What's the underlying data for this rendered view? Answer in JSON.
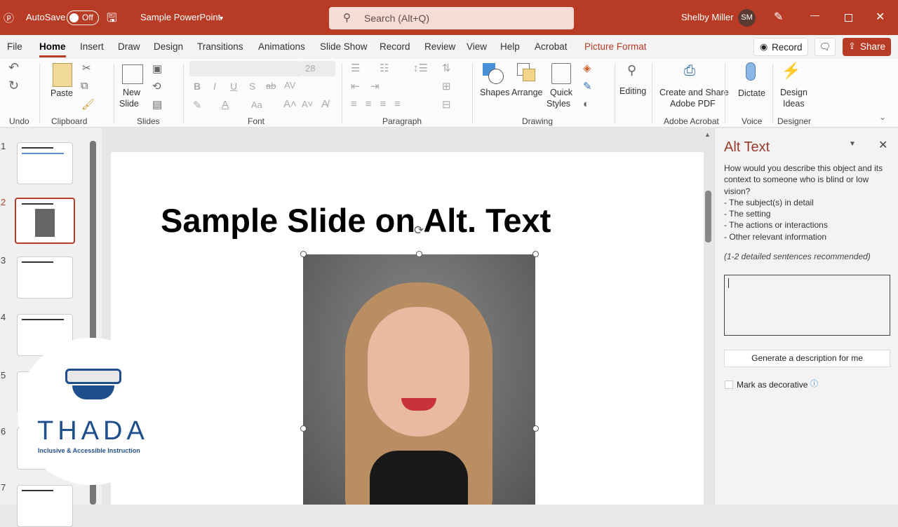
{
  "titlebar": {
    "autosave_label": "AutoSave",
    "autosave_state": "Off",
    "doc_title": "Sample PowerPoint",
    "search_placeholder": "Search (Alt+Q)",
    "user_name": "Shelby Miller",
    "user_initials": "SM"
  },
  "tabs": [
    "File",
    "Home",
    "Insert",
    "Draw",
    "Design",
    "Transitions",
    "Animations",
    "Slide Show",
    "Record",
    "Review",
    "View",
    "Help",
    "Acrobat",
    "Picture Format"
  ],
  "tab_actions": {
    "record": "Record",
    "share": "Share"
  },
  "ribbon": {
    "undo_group": "Undo",
    "clipboard_group": "Clipboard",
    "paste": "Paste",
    "slides_group": "Slides",
    "new_slide_1": "New",
    "new_slide_2": "Slide",
    "font_group": "Font",
    "font_size": "28",
    "paragraph_group": "Paragraph",
    "shapes": "Shapes",
    "arrange": "Arrange",
    "quick_styles_1": "Quick",
    "quick_styles_2": "Styles",
    "drawing_group": "Drawing",
    "editing": "Editing",
    "acrobat_1": "Create and Share",
    "acrobat_2": "Adobe PDF",
    "acrobat_group": "Adobe Acrobat",
    "dictate": "Dictate",
    "voice_group": "Voice",
    "design_ideas_1": "Design",
    "design_ideas_2": "Ideas",
    "designer_group": "Designer"
  },
  "thumbnails": [
    {
      "n": "1"
    },
    {
      "n": "2"
    },
    {
      "n": "3"
    },
    {
      "n": "4"
    },
    {
      "n": "5"
    },
    {
      "n": "6"
    },
    {
      "n": "7"
    }
  ],
  "slide": {
    "title": "Sample Slide on Alt. Text"
  },
  "logo": {
    "name": "THADA",
    "tagline": "Inclusive & Accessible Instruction"
  },
  "alt_text": {
    "title": "Alt Text",
    "prompt": "How would you describe this object and its context to someone who is blind or low vision?",
    "bullets": [
      "- The subject(s) in detail",
      "- The setting",
      "- The actions or interactions",
      "- Other relevant information"
    ],
    "hint": "(1-2 detailed sentences recommended)",
    "input_value": "",
    "generate_button": "Generate a description for me",
    "decorative_label": "Mark as decorative"
  },
  "colors": {
    "accent": "#b83c25",
    "logo_blue": "#1f4e8c"
  }
}
